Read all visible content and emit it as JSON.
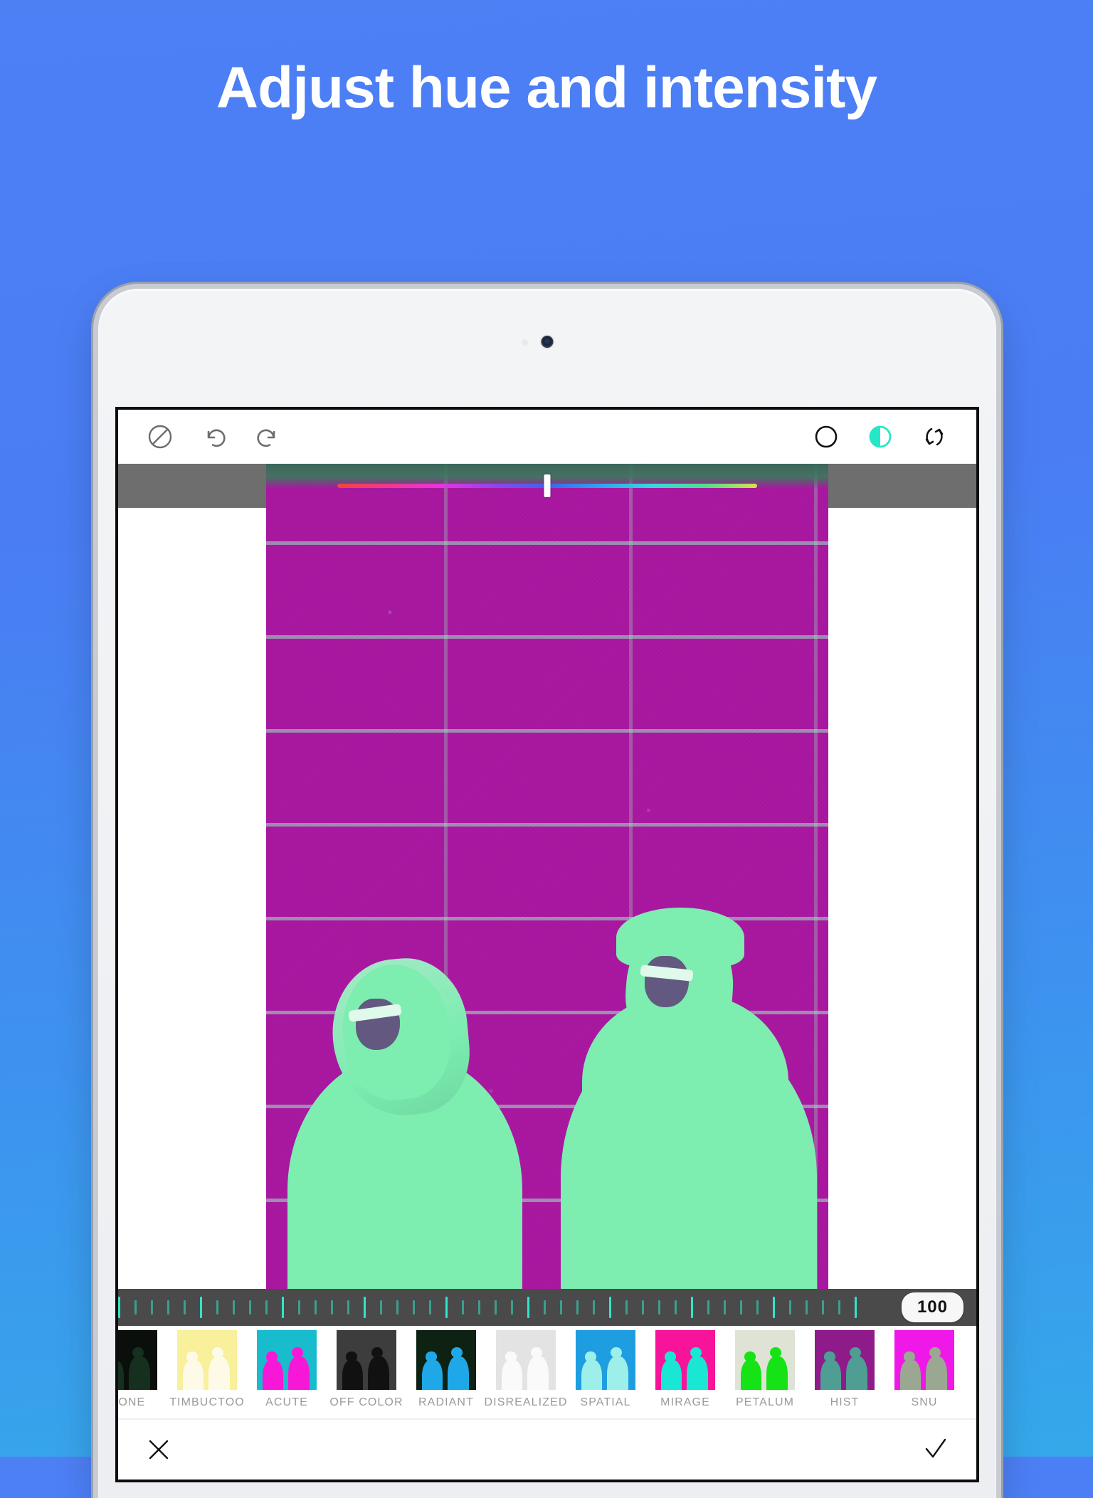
{
  "promo": {
    "headline": "Adjust hue and intensity",
    "background_color": "#4a7df4"
  },
  "device": {
    "type": "tablet",
    "camera": "front-camera"
  },
  "app": {
    "toolbar": {
      "left_icons": [
        {
          "name": "no-filter-icon",
          "label": "None"
        },
        {
          "name": "undo-icon",
          "label": "Undo"
        },
        {
          "name": "redo-icon",
          "label": "Redo"
        }
      ],
      "right_icons": [
        {
          "name": "circle-outline-icon",
          "label": "Mask",
          "active": false
        },
        {
          "name": "half-circle-icon",
          "label": "Hue",
          "active": true,
          "color": "#25e8c8"
        },
        {
          "name": "compare-arrows-icon",
          "label": "Compare",
          "active": false
        }
      ]
    },
    "hue_slider": {
      "name": "hue-slider",
      "value_percent": 50,
      "gradient_stops": [
        "#f0443a",
        "#ef3a8e",
        "#e435e0",
        "#8a46ef",
        "#3a66f0",
        "#2fa4ef",
        "#35d9e0",
        "#4fe08a",
        "#d9e04a"
      ]
    },
    "intensity": {
      "name": "intensity-ruler",
      "value": "100",
      "tick_color": "#2fe6c8",
      "track_color": "#4a4a4a"
    },
    "photo": {
      "name": "edited-photo",
      "description": "Two people in front of a brick wall, duotone magenta and mint",
      "background_color": "#a8189f",
      "subject_color": "#7dedb0"
    },
    "filters": [
      {
        "label": "NONE",
        "bg": "#0b0f0c",
        "subject": "#15301f",
        "selected": false
      },
      {
        "label": "TIMBUCTOO",
        "bg": "#f8f09a",
        "subject": "#fdfbe8",
        "selected": false
      },
      {
        "label": "ACUTE",
        "bg": "#18bccd",
        "subject": "#f618d6",
        "selected": false
      },
      {
        "label": "OFF COLOR",
        "bg": "#3d3d3d",
        "subject": "#111111",
        "selected": false
      },
      {
        "label": "RADIANT",
        "bg": "#0d2212",
        "subject": "#1fa8e8",
        "selected": false
      },
      {
        "label": "DISREALIZED",
        "bg": "#e3e3e3",
        "subject": "#fafafa",
        "selected": false
      },
      {
        "label": "SPATIAL",
        "bg": "#1e9ee0",
        "subject": "#9df0ea",
        "selected": false
      },
      {
        "label": "MIRAGE",
        "bg": "#f7149b",
        "subject": "#1ae6d4",
        "selected": false
      },
      {
        "label": "PETALUM",
        "bg": "#dfe3d5",
        "subject": "#16e316",
        "selected": false
      },
      {
        "label": "HIST",
        "bg": "#8f1a8a",
        "subject": "#4f9e93",
        "selected": true
      },
      {
        "label": "SNU",
        "bg": "#f018e8",
        "subject": "#9aa892",
        "selected": false
      }
    ],
    "actions": [
      {
        "name": "cancel-button",
        "icon": "close-icon"
      },
      {
        "name": "confirm-button",
        "icon": "check-icon"
      }
    ]
  }
}
